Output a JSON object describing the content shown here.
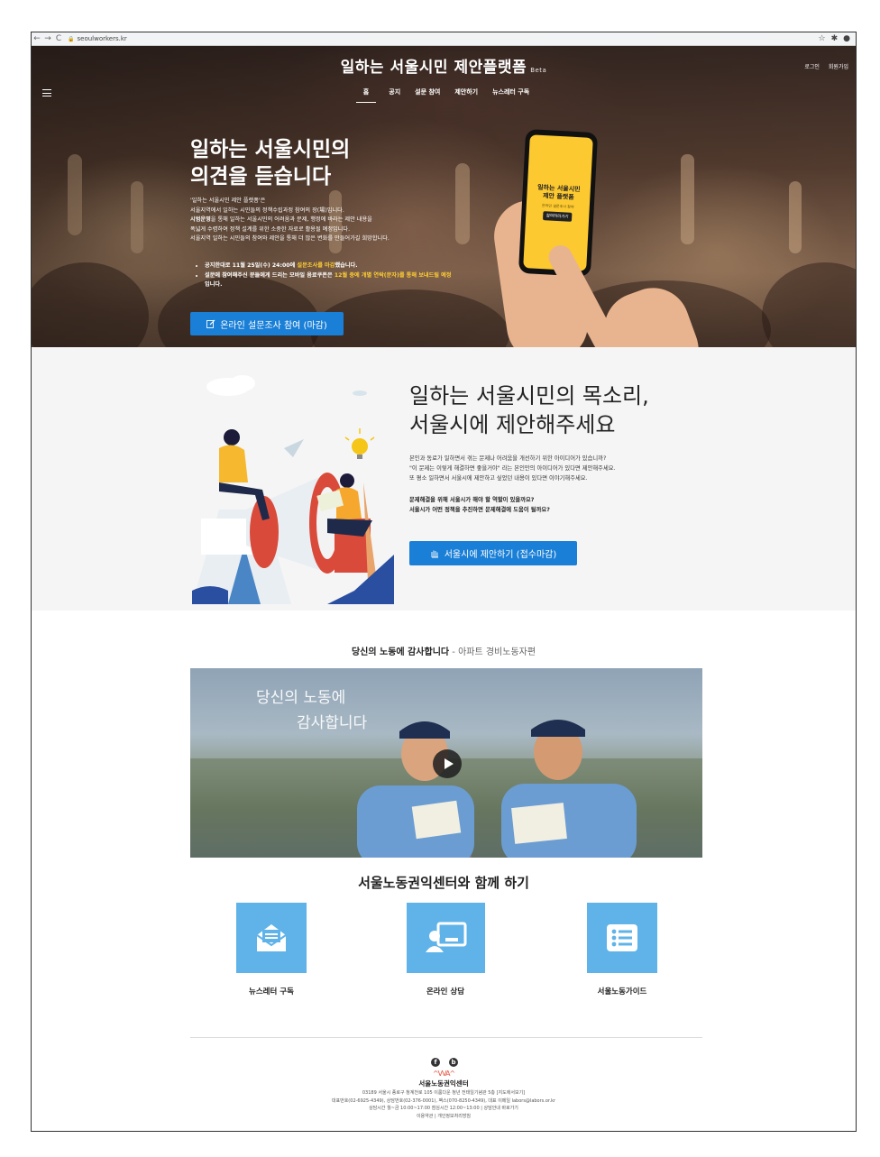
{
  "browser": {
    "url": "seoulworkers.kr",
    "back": "←",
    "forward": "→",
    "reload": "C",
    "lock": "🔒",
    "star": "☆",
    "extension": "✱",
    "profile": "●"
  },
  "header": {
    "site_title": "일하는 서울시민 제안플랫폼",
    "beta": "Beta",
    "login": "로그인",
    "signup": "회원가입",
    "nav": [
      "홈",
      "공지",
      "설문 참여",
      "제안하기",
      "뉴스레터 구독"
    ]
  },
  "hero": {
    "heading_line1": "일하는 서울시민의",
    "heading_line2": "의견을 듣습니다",
    "desc_lines": [
      "'일하는 서울시민 제안 플랫폼'은",
      "서울지역에서 일하는 시민들의 정책수립과정 참여의 장(場)입니다.",
      "시범운영을 통해 일하는 서울시민의 어려움과 문제, 행정에 바라는 제안 내용을",
      "폭넓게 수렴하여 정책 설계를 위한 소중한 자료로 활용될 예정입니다.",
      "서울지역 일하는 시민들의 참여와 제안을 통해 더 많은 변화를 만들어가길 희망합니다."
    ],
    "desc_bold_word": "시범운영",
    "bullet1_a": "공지한대로 11월 25일(수) 24:00에 ",
    "bullet1_hl": "설문조사를 마감",
    "bullet1_b": "했습니다.",
    "bullet2_a": "설문에 참여해주신 분들에게 드리는 모바일 음료쿠폰은 ",
    "bullet2_hl": "12월 중에 개별 연락(문자)를 통해 보내드릴 예정",
    "bullet2_b": "입니다.",
    "survey_button": "온라인 설문조사 참여 (마감)",
    "phone_title_1": "일하는 서울시민",
    "phone_title_2": "제안 플랫폼",
    "phone_sub": "온라인 설문조사 참여",
    "phone_button": "참여하러가기"
  },
  "proposal": {
    "heading_line1": "일하는 서울시민의 목소리,",
    "heading_line2": "서울시에 제안해주세요",
    "desc_lines": [
      "본인과 동료가 일하면서 겪는 문제나 어려움을 개선하기 위한 아이디어가 있습니까?",
      "\"이 문제는 이렇게 해결하면 좋을거야\" 라는 본인만의 아이디어가 있다면 제안해주세요.",
      "또 평소 일하면서 서울시에 제안하고 싶었던 내용이 있다면 이야기해주세요."
    ],
    "question_lines": [
      "문제해결을 위해 서울시가 해야 할 역할이 있을까요?",
      "서울시가 어떤 정책을 추진하면 문제해결에 도움이 될까요?"
    ],
    "button": "서울시에 제안하기 (접수마감)"
  },
  "video": {
    "title": "당신의 노동에 감사합니다",
    "subtitle": " - 아파트 경비노동자편",
    "caption1": "당신의 노동에",
    "caption2": "감사합니다"
  },
  "together": {
    "title": "서울노동권익센터와 함께 하기",
    "items": [
      {
        "label": "뉴스레터 구독",
        "icon": "envelope-icon"
      },
      {
        "label": "온라인 상담",
        "icon": "consult-icon"
      },
      {
        "label": "서울노동가이드",
        "icon": "list-icon"
      }
    ]
  },
  "footer": {
    "facebook": "f",
    "blog": "b",
    "logo_mark": "^VVA^",
    "org": "서울노동권익센터",
    "info_lines": [
      "03189 서울시 종로구 청계천로 105 이룸다운 청년 전태일기념관 5층 [지도에서보기]",
      "대표번호(02-6925-4349), 상담번호(02-376-0001), 팩스(070-8250-4349), 대표 이메일 labors@labors.or.kr",
      "상담시간 월~금 10:00~17:00 점심시간 12:00~13:00 | 상담안내 바로가기",
      "이용약관  |  개인정보처리방침"
    ]
  },
  "colors": {
    "accent": "#1a7fd6",
    "highlight": "#ffcf33",
    "tile": "#5fb3e9",
    "phone_screen": "#fdc930"
  }
}
